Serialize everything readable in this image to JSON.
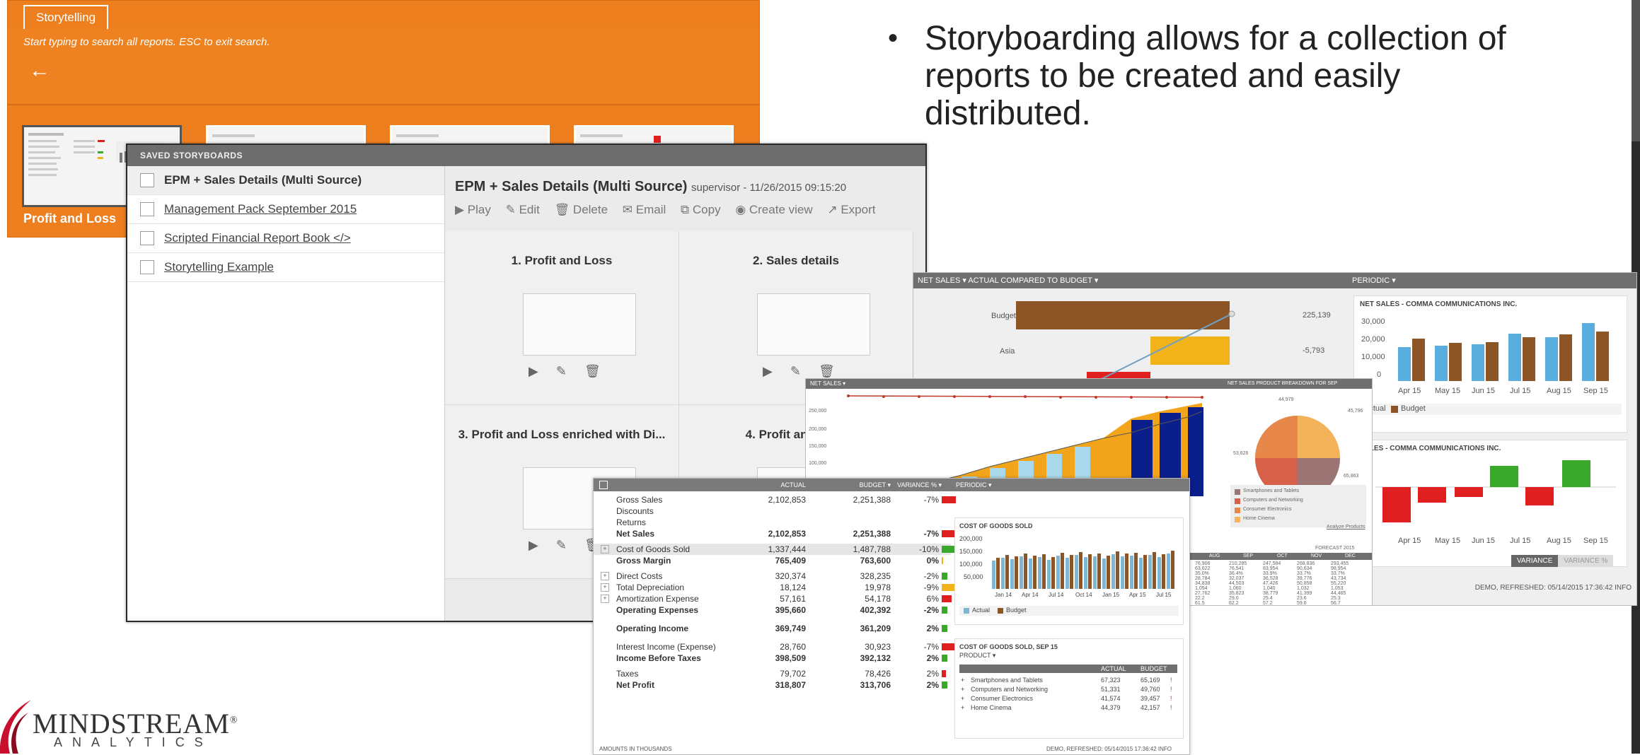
{
  "bullet": {
    "dot": "•",
    "text": "Storyboarding allows for a collection of reports to be created and easily distributed."
  },
  "storytelling": {
    "tab": "Storytelling",
    "hint": "Start typing to search all reports. ESC to exit search.",
    "back_glyph": "←",
    "caption": "Profit and Loss"
  },
  "saved": {
    "bar_title": "SAVED STORYBOARDS",
    "items": [
      "EPM + Sales Details (Multi Source)",
      "Management Pack September 2015",
      "Scripted Financial Report Book </>",
      "Storytelling Example"
    ],
    "detail": {
      "title": "EPM + Sales Details (Multi Source)",
      "meta": "supervisor - 11/26/2015 09:15:20",
      "toolbar": [
        "▶ Play",
        "✎ Edit",
        "🗑 Delete",
        "✉ Email",
        "⧉ Copy",
        "◉ Create view",
        "↗ Export"
      ],
      "cards": [
        "1. Profit and Loss",
        "2. Sales details",
        "3. Profit and Loss enriched with Di...",
        "4. Profit and Loss"
      ],
      "card_actions": [
        "▶",
        "✎",
        "🗑"
      ]
    }
  },
  "net_sales": {
    "bar_left": "NET SALES ▾ ACTUAL COMPARED TO BUDGET ▾",
    "bar_right": "PERIODIC ▾",
    "budget_label": "Budget",
    "asia_label": "Asia",
    "budget_value": "225,139",
    "asia_value": "-5,793",
    "periodic_title1": "NET SALES - COMMA COMMUNICATIONS INC.",
    "periodic_title2": "SALES - COMMA COMMUNICATIONS INC.",
    "y_ticks": [
      "30,000",
      "20,000",
      "10,000",
      "0"
    ],
    "months": [
      "Apr 15",
      "May 15",
      "Jun 15",
      "Jul 15",
      "Aug 15",
      "Sep 15"
    ],
    "legend_actual": "Actual",
    "legend_budget": "Budget",
    "tab_on": "VARIANCE",
    "tab_off": "VARIANCE %",
    "footer": "DEMO, REFRESHED: 05/14/2015 17:36:42 INFO",
    "colors": {
      "actual": "#5aaedd",
      "budget": "#8b5526",
      "green": "#3aa82a",
      "red": "#e02020"
    }
  },
  "area": {
    "bar": "NET SALES ▾",
    "pie_bar": "NET SALES PRODUCT BREAKDOWN FOR SEP",
    "y_ticks": [
      "250,000",
      "200,000",
      "150,000",
      "100,000"
    ],
    "pie_values": [
      "44,979",
      "45,796",
      "53,626",
      "65,863"
    ],
    "pie_legend": [
      "Smartphones and Tablets",
      "Computers and Networking",
      "Consumer Electronics",
      "Home Cinema"
    ],
    "analyze": "Analyze Products",
    "forecast": "FORECAST 2015",
    "months": [
      "AUG",
      "SEP",
      "OCT",
      "NOV",
      "DEC"
    ],
    "rows": [
      [
        "76,906",
        "210,285",
        "247,584",
        "268,836",
        "293,455"
      ],
      [
        "63,622",
        "76,541",
        "83,954",
        "90,634",
        "98,954"
      ],
      [
        "35.0%",
        "36.4%",
        "33.9%",
        "33.7%",
        "33.7%"
      ],
      [
        "28,784",
        "32,037",
        "36,528",
        "39,776",
        "43,734"
      ],
      [
        "34,838",
        "44,503",
        "47,426",
        "50,858",
        "55,220"
      ],
      [
        "1,054",
        "1,060",
        "1,040",
        "1,032",
        "1,053"
      ],
      [
        "27,762",
        "35,823",
        "38,779",
        "41,399",
        "44,465"
      ],
      [
        "22.2",
        "29.0",
        "25.4",
        "23.6",
        "25.3"
      ],
      [
        "61.5",
        "62.2",
        "57.2",
        "59.6",
        "56.7"
      ]
    ]
  },
  "pl": {
    "headers": [
      "ACTUAL",
      "BUDGET ▾",
      "VARIANCE % ▾",
      "PERIODIC ▾"
    ],
    "rows": [
      {
        "name": "Gross Sales",
        "a": "2,102,853",
        "b": "2,251,388",
        "v": "-7%"
      },
      {
        "name": "Discounts",
        "a": "",
        "b": "",
        "v": ""
      },
      {
        "name": "Returns",
        "a": "",
        "b": "",
        "v": ""
      },
      {
        "name": "Net Sales",
        "a": "2,102,853",
        "b": "2,251,388",
        "v": "-7%"
      },
      {
        "name": "Cost of Goods Sold",
        "a": "1,337,444",
        "b": "1,487,788",
        "v": "-10%"
      },
      {
        "name": "Gross Margin",
        "a": "765,409",
        "b": "763,600",
        "v": "0%"
      },
      {
        "name": "Direct Costs",
        "a": "320,374",
        "b": "328,235",
        "v": "-2%"
      },
      {
        "name": "Total Depreciation",
        "a": "18,124",
        "b": "19,978",
        "v": "-9%"
      },
      {
        "name": "Amortization Expense",
        "a": "57,161",
        "b": "54,178",
        "v": "6%"
      },
      {
        "name": "Operating Expenses",
        "a": "395,660",
        "b": "402,392",
        "v": "-2%"
      },
      {
        "name": "Operating Income",
        "a": "369,749",
        "b": "361,209",
        "v": "2%"
      },
      {
        "name": "Interest Income (Expense)",
        "a": "28,760",
        "b": "30,923",
        "v": "-7%"
      },
      {
        "name": "Income Before Taxes",
        "a": "398,509",
        "b": "392,132",
        "v": "2%"
      },
      {
        "name": "Taxes",
        "a": "79,702",
        "b": "78,426",
        "v": "2%"
      },
      {
        "name": "Net Profit",
        "a": "318,807",
        "b": "313,706",
        "v": "2%"
      }
    ],
    "cogs_title": "COST OF GOODS SOLD",
    "cogs_ticks": [
      "200,000",
      "150,000",
      "100,000",
      "50,000"
    ],
    "cogs_months": [
      "Jan 14",
      "Apr 14",
      "Jul 14",
      "Oct 14",
      "Jan 15",
      "Apr 15",
      "Jul 15"
    ],
    "cogs2_title": "COST OF GOODS SOLD, SEP 15",
    "cogs2_sub": "PRODUCT ▾",
    "cogs2_heads": [
      "ACTUAL",
      "BUDGET"
    ],
    "cogs2_rows": [
      [
        "Smartphones and Tablets",
        "67,323",
        "65,169"
      ],
      [
        "Computers and Networking",
        "51,331",
        "49,760"
      ],
      [
        "Consumer Electronics",
        "41,574",
        "39,457"
      ],
      [
        "Home Cinema",
        "44,379",
        "42,157"
      ]
    ],
    "foot_left": "AMOUNTS IN THOUSANDS",
    "foot_right": "DEMO, REFRESHED: 05/14/2015 17:36:42 INFO"
  },
  "logo": {
    "word": "MINDSTREAM",
    "reg": "®",
    "sub": "ANALYTICS"
  }
}
